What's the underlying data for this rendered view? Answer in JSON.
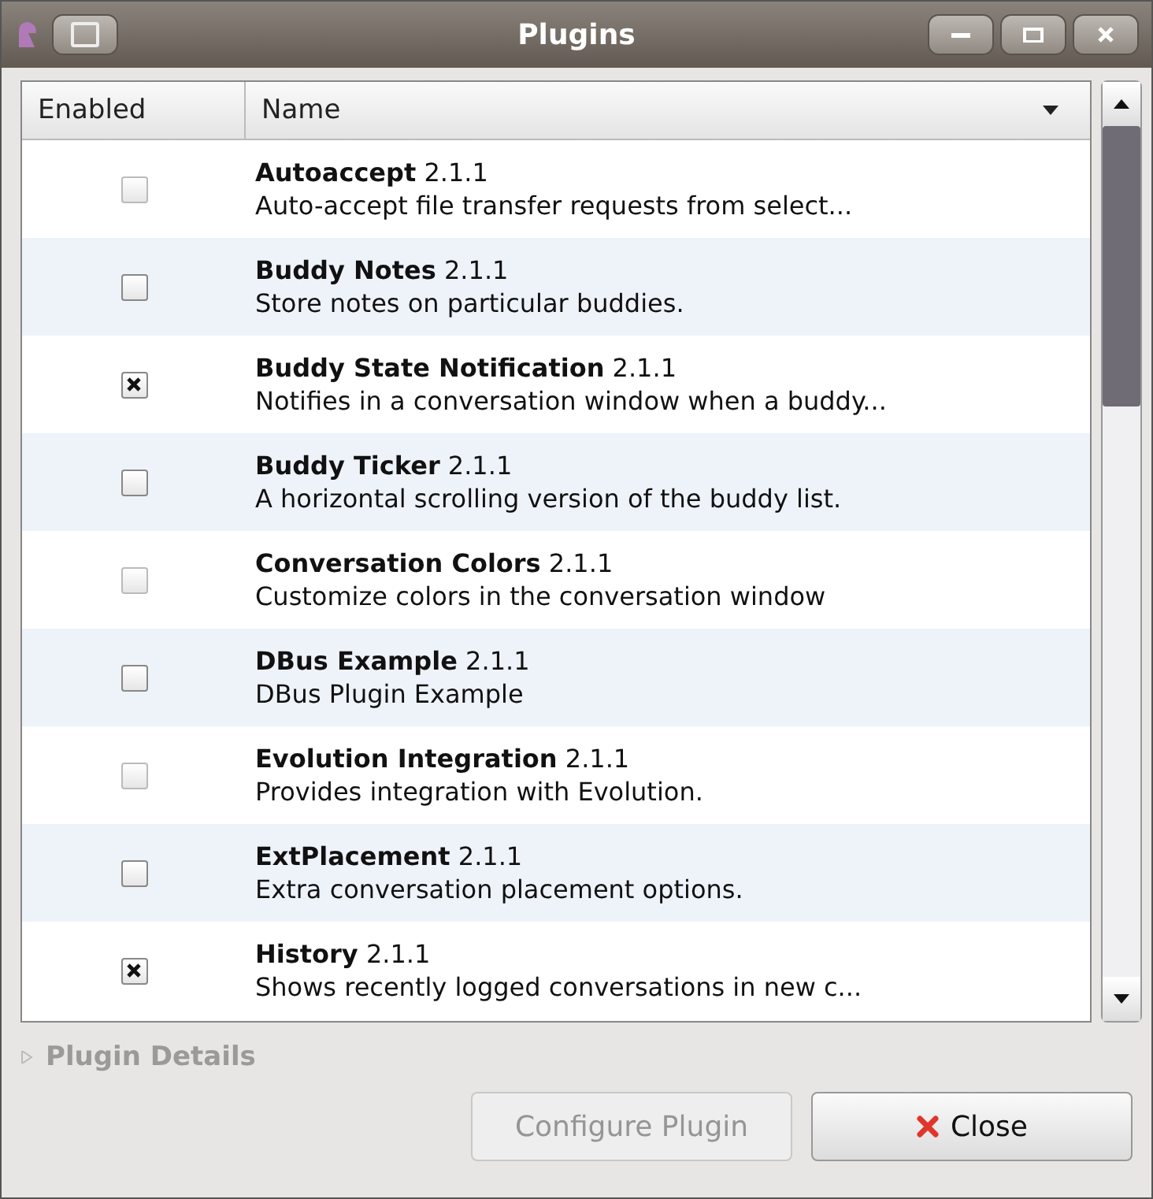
{
  "window": {
    "title": "Plugins"
  },
  "columns": [
    "Enabled",
    "Name"
  ],
  "plugins": [
    {
      "name": "Autoaccept",
      "version": "2.1.1",
      "description": "Auto-accept file transfer requests from select...",
      "enabled": false,
      "disabled": true
    },
    {
      "name": "Buddy Notes",
      "version": "2.1.1",
      "description": "Store notes on particular buddies.",
      "enabled": false,
      "disabled": false
    },
    {
      "name": "Buddy State Notification",
      "version": "2.1.1",
      "description": "Notifies in a conversation window when a buddy...",
      "enabled": true,
      "disabled": false
    },
    {
      "name": "Buddy Ticker",
      "version": "2.1.1",
      "description": "A horizontal scrolling version of the buddy list.",
      "enabled": false,
      "disabled": false
    },
    {
      "name": "Conversation Colors",
      "version": "2.1.1",
      "description": "Customize colors in the conversation window",
      "enabled": false,
      "disabled": true
    },
    {
      "name": "DBus Example",
      "version": "2.1.1",
      "description": "DBus Plugin Example",
      "enabled": false,
      "disabled": false
    },
    {
      "name": "Evolution Integration",
      "version": "2.1.1",
      "description": "Provides integration with Evolution.",
      "enabled": false,
      "disabled": true
    },
    {
      "name": "ExtPlacement",
      "version": "2.1.1",
      "description": "Extra conversation placement options.",
      "enabled": false,
      "disabled": false
    },
    {
      "name": "History",
      "version": "2.1.1",
      "description": "Shows recently logged conversations in new c...",
      "enabled": true,
      "disabled": false
    }
  ],
  "details": {
    "label": "Plugin Details",
    "expanded": false,
    "disabled": true
  },
  "buttons": [
    {
      "label": "Configure Plugin",
      "disabled": true,
      "kind": "plain"
    },
    {
      "label": "Close",
      "disabled": false,
      "kind": "close"
    }
  ]
}
